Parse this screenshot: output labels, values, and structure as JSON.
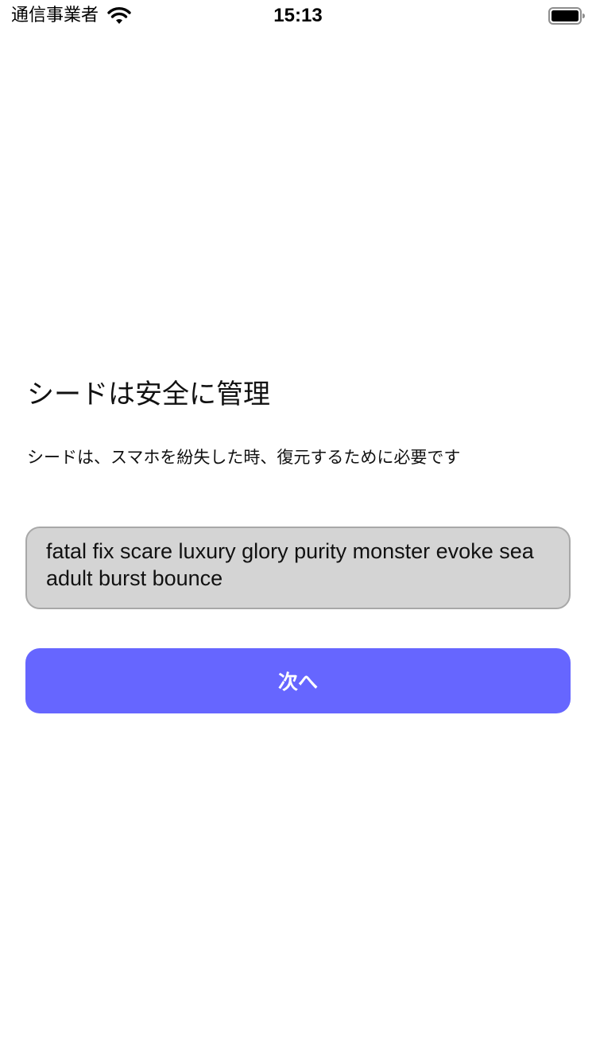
{
  "status_bar": {
    "carrier": "通信事業者",
    "time": "15:13",
    "wifi_icon": "wifi-icon",
    "battery_icon": "battery-icon"
  },
  "main": {
    "title": "シードは安全に管理",
    "description": "シードは、スマホを紛失した時、復元するために必要です",
    "seed_phrase": "fatal fix scare luxury glory purity monster evoke sea adult burst bounce",
    "next_label": "次へ"
  },
  "colors": {
    "accent": "#6666ff",
    "seed_box_bg": "#d4d4d4",
    "seed_box_border": "#a8a8a8"
  }
}
